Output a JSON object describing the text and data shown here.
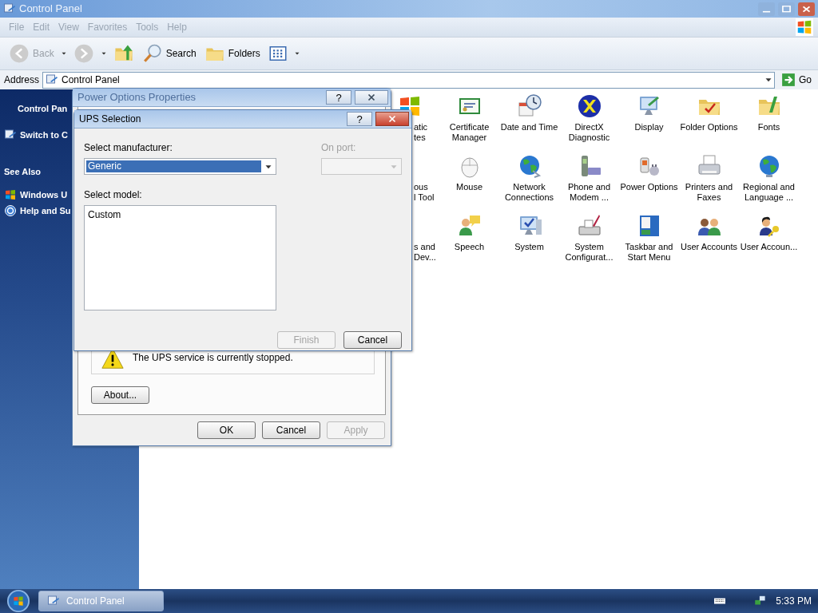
{
  "window": {
    "title": "Control Panel"
  },
  "menu": [
    "File",
    "Edit",
    "View",
    "Favorites",
    "Tools",
    "Help"
  ],
  "toolbar": [
    {
      "kind": "back",
      "label": "Back",
      "disabled": true
    },
    {
      "kind": "forward",
      "disabled": true
    },
    {
      "kind": "up",
      "disabled": false
    },
    {
      "kind": "search",
      "label": "Search",
      "disabled": false
    },
    {
      "kind": "folders",
      "label": "Folders",
      "disabled": false
    },
    {
      "kind": "views",
      "disabled": false
    }
  ],
  "address": {
    "label": "Address",
    "value": "Control Panel",
    "go": "Go"
  },
  "sidebar": {
    "title": "Control Pan",
    "switch_link": "Switch to C",
    "see_also": "See Also",
    "links": [
      {
        "kind": "windows",
        "label": "Windows U"
      },
      {
        "kind": "help",
        "label": "Help and Su"
      }
    ]
  },
  "icon_rows": [
    [
      {
        "kind": "partial_flag",
        "label": "atic\ntes"
      },
      {
        "kind": "certificate",
        "label": "Certificate Manager"
      },
      {
        "kind": "datetime",
        "label": "Date and Time"
      },
      {
        "kind": "directx",
        "label": "DirectX Diagnostic"
      },
      {
        "kind": "display",
        "label": "Display"
      },
      {
        "kind": "folder_check",
        "label": "Folder Options"
      },
      {
        "kind": "folder_font",
        "label": "Fonts"
      }
    ],
    [
      {
        "kind": "partial",
        "label": "ous\nl Tool"
      },
      {
        "kind": "mouse",
        "label": "Mouse"
      },
      {
        "kind": "globe_net",
        "label": "Network Connections"
      },
      {
        "kind": "phone",
        "label": "Phone and Modem ..."
      },
      {
        "kind": "power",
        "label": "Power Options"
      },
      {
        "kind": "printer",
        "label": "Printers and Faxes"
      },
      {
        "kind": "globe",
        "label": "Regional and Language ..."
      }
    ],
    [
      {
        "kind": "partial",
        "label": "s and\nDev..."
      },
      {
        "kind": "speech",
        "label": "Speech"
      },
      {
        "kind": "system",
        "label": "System"
      },
      {
        "kind": "sysconfig",
        "label": "System Configurat..."
      },
      {
        "kind": "taskbar",
        "label": "Taskbar and Start Menu"
      },
      {
        "kind": "users",
        "label": "User Accounts"
      },
      {
        "kind": "userkey",
        "label": "User Accoun..."
      }
    ]
  ],
  "power_dialog": {
    "title": "Power Options Properties",
    "help": "?",
    "status": "The UPS service is currently stopped.",
    "about": "About...",
    "buttons": [
      {
        "label": "OK",
        "disabled": false
      },
      {
        "label": "Cancel",
        "disabled": false
      },
      {
        "label": "Apply",
        "disabled": true
      }
    ]
  },
  "ups_dialog": {
    "title": "UPS Selection",
    "help": "?",
    "manufacturer_label": "Select manufacturer:",
    "manufacturer": "Generic",
    "port_label": "On port:",
    "port_disabled": true,
    "model_label": "Select model:",
    "models": [
      {
        "label": "Custom",
        "selected": false
      }
    ],
    "buttons": [
      {
        "label": "Finish",
        "disabled": true
      },
      {
        "label": "Cancel",
        "disabled": false
      }
    ]
  },
  "taskbar": {
    "tasks": [
      {
        "label": "Control Panel",
        "selected": false
      }
    ],
    "clock": "5:33 PM"
  }
}
